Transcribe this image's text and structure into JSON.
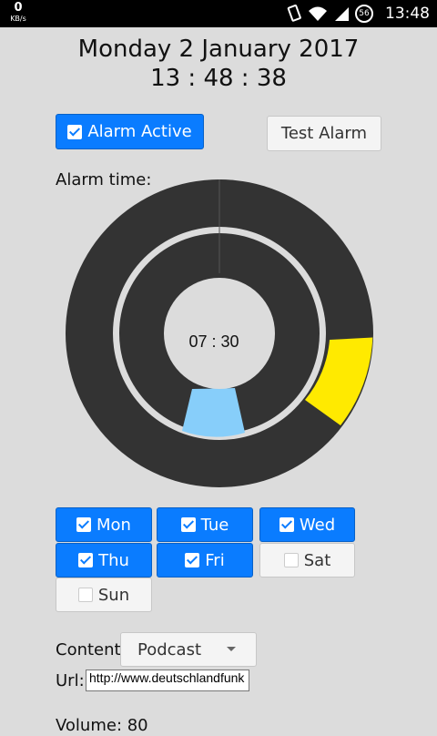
{
  "status_bar": {
    "speed_value": "0",
    "speed_unit": "KB/s",
    "badge": "56",
    "time": "13:48",
    "icons": [
      "vibrate-icon",
      "wifi-icon",
      "signal-icon",
      "battery-icon"
    ]
  },
  "header": {
    "date": "Monday 2 January 2017",
    "time": "13 : 48 : 38"
  },
  "alarm_active": {
    "label": "Alarm Active",
    "checked": true
  },
  "test_alarm": {
    "label": "Test Alarm"
  },
  "alarm_time": {
    "label": "Alarm time:",
    "value": "07 : 30",
    "hour_ring_color": "#ffea00",
    "minute_ring_color": "#87cefa",
    "dial_color": "#333333"
  },
  "days": [
    {
      "label": "Mon",
      "checked": true
    },
    {
      "label": "Tue",
      "checked": true
    },
    {
      "label": "Wed",
      "checked": true
    },
    {
      "label": "Thu",
      "checked": true
    },
    {
      "label": "Fri",
      "checked": true
    },
    {
      "label": "Sat",
      "checked": false
    },
    {
      "label": "Sun",
      "checked": false
    }
  ],
  "content": {
    "label": "Content:",
    "selected": "Podcast"
  },
  "url": {
    "label": "Url:",
    "value": "http://www.deutschlandfunk"
  },
  "volume": {
    "label": "Volume: 80"
  },
  "colors": {
    "accent": "#0a7cff",
    "background": "#dcdcdc"
  }
}
